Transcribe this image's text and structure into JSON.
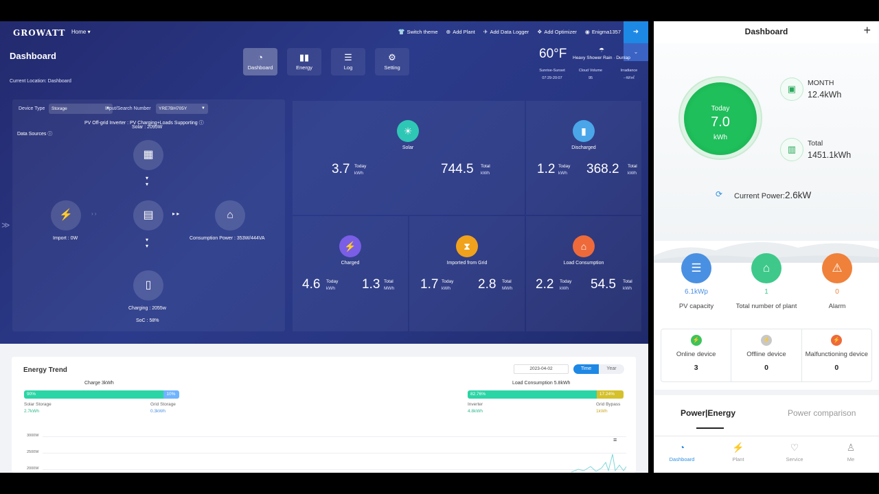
{
  "web": {
    "logo": "GROWATT",
    "home_label": "Home ▾",
    "top_links": [
      {
        "icon": "shirt-icon",
        "glyph": "👕",
        "label": "Switch theme"
      },
      {
        "icon": "plus-circle-icon",
        "glyph": "⊕",
        "label": "Add Plant"
      },
      {
        "icon": "send-icon",
        "glyph": "✈",
        "label": "Add Data Logger"
      },
      {
        "icon": "optimizer-icon",
        "glyph": "❖",
        "label": "Add Optimizer"
      },
      {
        "icon": "user-icon",
        "glyph": "◉",
        "label": "Enigma1357"
      }
    ],
    "page_title": "Dashboard",
    "location": "Current Location: Dashboard",
    "nav_tabs": [
      {
        "label": "Dashboard",
        "glyph": "◔"
      },
      {
        "label": "Energy",
        "glyph": "▮▮"
      },
      {
        "label": "Log",
        "glyph": "☰"
      },
      {
        "label": "Setting",
        "glyph": "⚙"
      }
    ],
    "weather": {
      "temp": "60°F",
      "desc": "Heavy Shower Rain · Dunlap",
      "stats": [
        {
          "label": "Sunrise-Sunset",
          "value": "07:29-20:07"
        },
        {
          "label": "Cloud Volume",
          "value": "95"
        },
        {
          "label": "Irradiance",
          "value": "--W/㎡"
        }
      ]
    },
    "flow": {
      "device_type_label": "Device Type",
      "device_type_value": "Storage",
      "sn_label": "Input/Search Number",
      "sn_value": "YRE7BH705Y",
      "pv_line": "PV Off-grid Inverter : PV Charging+Loads Supporting ⓘ",
      "solar_line": "Solar : 2095W",
      "data_sources": "Data Sources ⓘ",
      "import": "Import : 0W",
      "consumption": "Consumption Power : 353W/444VA",
      "charging": "Charging : 2055w",
      "soc": "SoC : 58%"
    },
    "stats": {
      "solar": {
        "name": "Solar",
        "today": "3.7",
        "today_unit": "kWh",
        "total": "744.5",
        "total_unit": "kWh"
      },
      "discharged": {
        "name": "Discharged",
        "today": "1.2",
        "today_unit": "kWh",
        "total": "368.2",
        "total_unit": "kWh"
      },
      "charged": {
        "name": "Charged",
        "today": "4.6",
        "today_unit": "kWh",
        "total": "1.3",
        "total_unit": "MWh"
      },
      "imported": {
        "name": "Imported from Grid",
        "today": "1.7",
        "today_unit": "kWh",
        "total": "2.8",
        "total_unit": "MWh"
      },
      "load": {
        "name": "Load Consumption",
        "today": "2.2",
        "today_unit": "kWh",
        "total": "54.5",
        "total_unit": "kWh"
      },
      "today_word": "Today",
      "total_word": "Total"
    },
    "trend": {
      "title": "Energy Trend",
      "date": "2023-04-02",
      "toggle": [
        "Time",
        "Year"
      ],
      "charge_label": "Charge  3kWh",
      "charge_bar": [
        {
          "label": "90%",
          "value": 90
        },
        {
          "label": "10%",
          "value": 10
        }
      ],
      "solar_storage": "Solar Storage",
      "solar_storage_val": "2.7kWh",
      "grid_storage": "Grid Storage",
      "grid_storage_val": "0.3kWh",
      "load_label": "Load Consumption  5.8kWh",
      "load_bar": [
        {
          "label": "82.76%",
          "value": 82.76
        },
        {
          "label": "17.24%",
          "value": 17.24
        }
      ],
      "inverter": "Inverter",
      "inverter_val": "4.8kWh",
      "grid_bypass": "Grid Bypass",
      "grid_bypass_val": "1kWh",
      "y_ticks": [
        "3000W",
        "2500W",
        "2000W"
      ]
    }
  },
  "mobile": {
    "title": "Dashboard",
    "today_label": "Today",
    "today_value": "7.0",
    "today_unit": "kWh",
    "month_label": "MONTH",
    "month_value": "12.4kWh",
    "total_label": "Total",
    "total_value": "1451.1kWh",
    "current_power_label": "Current Power:",
    "current_power_value": "2.6kW",
    "kpis": [
      {
        "value": "6.1kWp",
        "label": "PV capacity",
        "color": "#4a90e2"
      },
      {
        "value": "1",
        "label": "Total number of plant",
        "color": "#3ec98a"
      },
      {
        "value": "0",
        "label": "Alarm",
        "color": "#f0813a"
      }
    ],
    "devices": [
      {
        "label": "Online device",
        "count": "3",
        "color": "#3ec35a"
      },
      {
        "label": "Offline device",
        "count": "0",
        "color": "#c8c8c8"
      },
      {
        "label": "Malfunctioning device",
        "count": "0",
        "color": "#ee6a3a"
      }
    ],
    "tabs": [
      "Power|Energy",
      "Power comparison"
    ],
    "bottom_nav": [
      {
        "label": "Dashboard",
        "glyph": "◔"
      },
      {
        "label": "Plant",
        "glyph": "⚡"
      },
      {
        "label": "Service",
        "glyph": "♡"
      },
      {
        "label": "Me",
        "glyph": "♙"
      }
    ]
  }
}
